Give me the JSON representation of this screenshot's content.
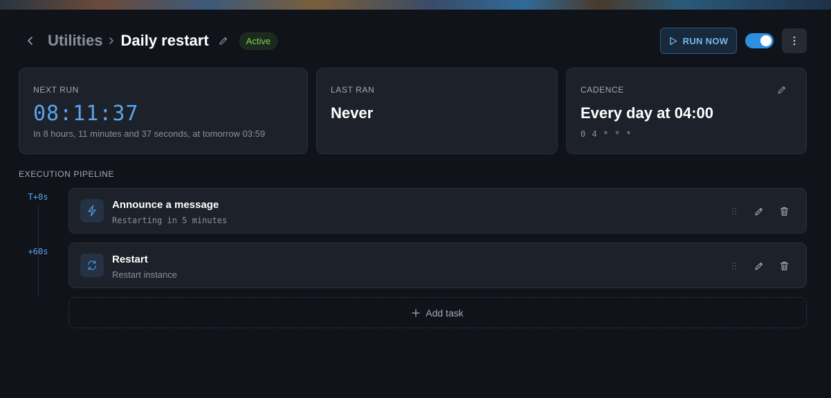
{
  "header": {
    "breadcrumb_parent": "Utilities",
    "title": "Daily restart",
    "status": "Active",
    "run_now_label": "RUN NOW",
    "enabled": true
  },
  "cards": {
    "next_run": {
      "label": "NEXT RUN",
      "countdown": "08:11:37",
      "detail": "In 8 hours, 11 minutes and 37 seconds, at tomorrow 03:59"
    },
    "last_ran": {
      "label": "LAST RAN",
      "value": "Never"
    },
    "cadence": {
      "label": "CADENCE",
      "value": "Every day at 04:00",
      "cron": "0 4 * * *"
    }
  },
  "pipeline": {
    "title": "EXECUTION PIPELINE",
    "tasks": [
      {
        "offset": "T+0s",
        "title": "Announce a message",
        "subtitle": "Restarting in 5 minutes",
        "icon": "lightning-icon"
      },
      {
        "offset": "+60s",
        "title": "Restart",
        "subtitle": "Restart instance",
        "icon": "refresh-icon"
      }
    ],
    "add_task_label": "Add task"
  },
  "colors": {
    "background": "#10131a",
    "card": "#1d2129",
    "accent": "#2d8fe0",
    "countdown": "#5aa4ec",
    "active_badge_text": "#7bd24f"
  }
}
